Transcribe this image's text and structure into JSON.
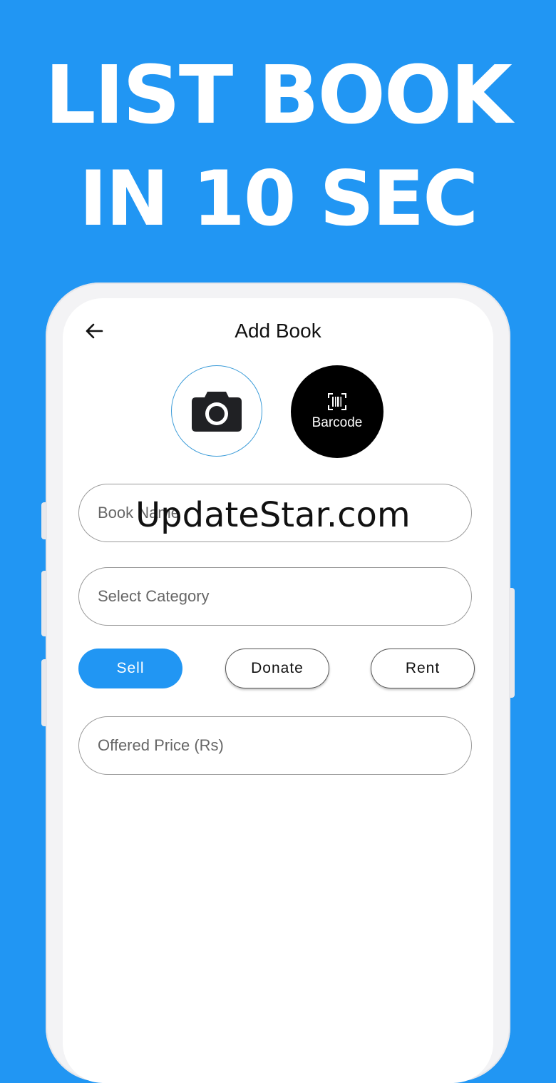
{
  "headline": {
    "line1": "LIST BOOK",
    "line2": "IN 10 SEC"
  },
  "screen": {
    "title": "Add Book",
    "back_icon": "arrow-left-icon",
    "camera_icon": "camera-icon",
    "barcode_icon": "barcode-scan-icon",
    "barcode_label": "Barcode"
  },
  "form": {
    "book_name_placeholder": "Book Name",
    "category_placeholder": "Select Category",
    "price_placeholder": "Offered Price (Rs)",
    "options": {
      "sell": "Sell",
      "donate": "Donate",
      "rent": "Rent"
    },
    "selected_option": "Sell"
  },
  "watermark": "UpdateStar.com",
  "colors": {
    "background": "#2196f3",
    "accent": "#2196f3",
    "barcode_button": "#000000"
  }
}
